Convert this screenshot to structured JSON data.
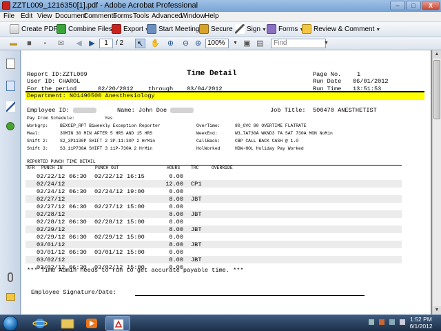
{
  "window": {
    "title": "ZZTL009_1216350[1].pdf - Adobe Acrobat Professional",
    "controls": {
      "minimize": "–",
      "maximize": "□",
      "close": "X"
    }
  },
  "menu": [
    "File",
    "Edit",
    "View",
    "Document",
    "Comments",
    "Forms",
    "Tools",
    "Advanced",
    "Window",
    "Help"
  ],
  "toolbar1": {
    "create_pdf": "Create PDF",
    "combine_files": "Combine Files",
    "export": "Export",
    "start_meeting": "Start Meeting",
    "secure": "Secure",
    "sign": "Sign",
    "forms": "Forms",
    "review_comment": "Review & Comment"
  },
  "toolbar2": {
    "page_current": "1",
    "page_total": "/ 2",
    "zoom": "100%",
    "find_placeholder": "Find"
  },
  "report": {
    "report_id": "Report ID:ZZTL009",
    "user_id": "User ID: CHAROL",
    "period_label": "For the period",
    "period_start": "02/20/2012",
    "through_label": "through",
    "period_end": "03/04/2012",
    "title": "Time Detail",
    "page_no_label": "Page No.",
    "page_no": "1",
    "run_date_label": "Run Date",
    "run_date": "06/01/2012",
    "run_time_label": "Run Time",
    "run_time": "13:51:53",
    "department": "Department: NO1490500 Anesthesiology",
    "employee_id_label": "Employee ID:",
    "name_label": "Name: John Doe",
    "job_title_label": "Job Title:",
    "job_title": "500470 ANESTHETIST",
    "pay_from_schedule_label": "Pay From Schedule:",
    "pay_from_schedule": "Yes",
    "info_left": [
      {
        "label": "Workgrp:",
        "value": "BEXCEP_RPT Biweekly Exception Reporter"
      },
      {
        "label": "Meal:",
        "value": "30MIN 30 MIN AFTER 5 HRS AND 15 HRS"
      },
      {
        "label": "Shift 2:",
        "value": "S2_3P1130P SHIFT 2 3P-11:30P 2 HrMin"
      },
      {
        "label": "Shift 3:",
        "value": "S3_11P730A SHIFT 3 11P-730A 2 HrMin"
      }
    ],
    "info_right": [
      {
        "label": "OverTime:",
        "value": "80_OVC 80 OVERTIME FLATRATE"
      },
      {
        "label": "WeekEnd:",
        "value": "W3_7A730A WKND3 7A SAT 730A MON NoMin"
      },
      {
        "label": "CallBack:",
        "value": "CBP CALL BACK CASH @ 1.0"
      },
      {
        "label": "HolWorked",
        "value": "HDW-HOL Holiday Pay Worked"
      }
    ],
    "detail_heading": "REPORTED PUNCH TIME DETAIL",
    "columns": {
      "xfr": "XFR",
      "punch_in": "PUNCH IN",
      "punch_out": "PUNCH OUT",
      "hours": "HOURS",
      "trc": "TRC",
      "override": "OVERRIDE"
    },
    "rows": [
      {
        "in_date": "02/22/12",
        "in_time": "06:30",
        "out_date": "02/22/12",
        "out_time": "16:15",
        "hours": "0.00",
        "trc": ""
      },
      {
        "in_date": "02/24/12",
        "in_time": "",
        "out_date": "",
        "out_time": "",
        "hours": "12.00",
        "trc": "CP1"
      },
      {
        "in_date": "02/24/12",
        "in_time": "06:30",
        "out_date": "02/24/12",
        "out_time": "19:00",
        "hours": "0.00",
        "trc": ""
      },
      {
        "in_date": "02/27/12",
        "in_time": "",
        "out_date": "",
        "out_time": "",
        "hours": "8.00",
        "trc": "JBT"
      },
      {
        "in_date": "02/27/12",
        "in_time": "06:30",
        "out_date": "02/27/12",
        "out_time": "15:00",
        "hours": "0.00",
        "trc": ""
      },
      {
        "in_date": "02/28/12",
        "in_time": "",
        "out_date": "",
        "out_time": "",
        "hours": "8.00",
        "trc": "JBT"
      },
      {
        "in_date": "02/28/12",
        "in_time": "06:30",
        "out_date": "02/28/12",
        "out_time": "15:00",
        "hours": "0.00",
        "trc": ""
      },
      {
        "in_date": "02/29/12",
        "in_time": "",
        "out_date": "",
        "out_time": "",
        "hours": "8.00",
        "trc": "JBT"
      },
      {
        "in_date": "02/29/12",
        "in_time": "06:30",
        "out_date": "02/29/12",
        "out_time": "15:00",
        "hours": "0.00",
        "trc": ""
      },
      {
        "in_date": "03/01/12",
        "in_time": "",
        "out_date": "",
        "out_time": "",
        "hours": "8.00",
        "trc": "JBT"
      },
      {
        "in_date": "03/01/12",
        "in_time": "06:30",
        "out_date": "03/01/12",
        "out_time": "15:00",
        "hours": "0.00",
        "trc": ""
      },
      {
        "in_date": "03/02/12",
        "in_time": "",
        "out_date": "",
        "out_time": "",
        "hours": "8.00",
        "trc": "JBT"
      },
      {
        "in_date": "03/02/12",
        "in_time": "06:30",
        "out_date": "03/02/12",
        "out_time": "15:00",
        "hours": "0.00",
        "trc": ""
      }
    ],
    "note": "*** Time Admin needs to run to get accurate payable time. ***",
    "signature_label": "Employee Signature/Date:"
  },
  "taskbar": {
    "clock_time": "1:52 PM",
    "clock_date": "6/1/2012"
  },
  "colors": {
    "highlight": "#ffff00",
    "row_shade": "#ececec",
    "acrobat_red": "#c8231c"
  }
}
